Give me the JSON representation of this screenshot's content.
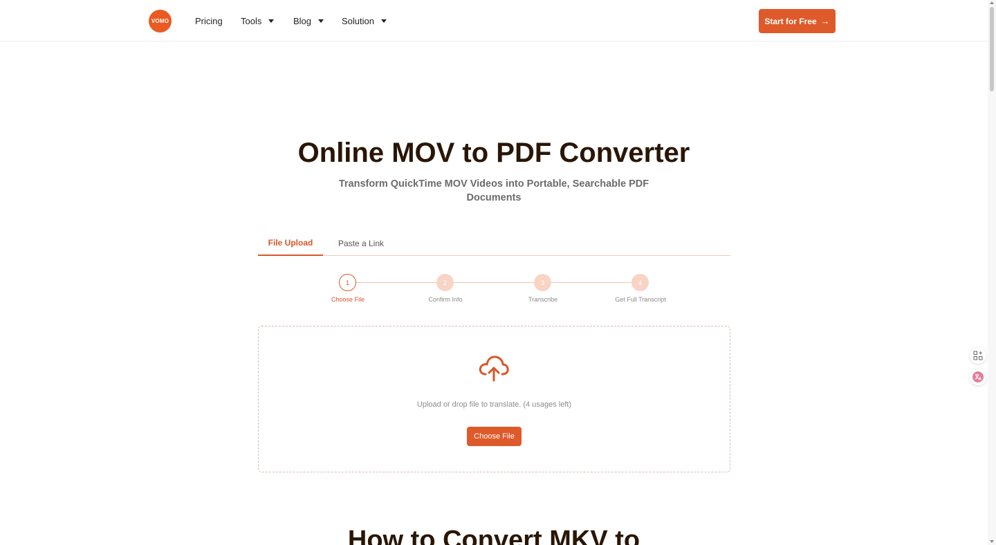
{
  "header": {
    "logo_text": "VOMO",
    "nav": {
      "pricing": "Pricing",
      "tools": "Tools",
      "blog": "Blog",
      "solution": "Solution"
    },
    "cta_label": "Start for Free",
    "cta_arrow": "→"
  },
  "hero": {
    "title": "Online MOV to PDF Converter",
    "subtitle": "Transform QuickTime MOV Videos into Portable, Searchable PDF Documents"
  },
  "tabs": [
    {
      "label": "File Upload",
      "active": true
    },
    {
      "label": "Paste a Link",
      "active": false
    }
  ],
  "steps": [
    {
      "number": "1",
      "label": "Choose File",
      "active": true
    },
    {
      "number": "2",
      "label": "Confirm Info",
      "active": false
    },
    {
      "number": "3",
      "label": "Transcribe",
      "active": false
    },
    {
      "number": "4",
      "label": "Get Full Transcript",
      "active": false
    }
  ],
  "upload": {
    "icon": "cloud-upload-icon",
    "hint": "Upload or drop file to translate. (4 usages left)",
    "button_label": "Choose File"
  },
  "next_section": {
    "heading": "How to Convert MKV to"
  },
  "colors": {
    "accent": "#df5a2a",
    "title": "#2a1606",
    "step_inactive": "#f8d4c4"
  }
}
